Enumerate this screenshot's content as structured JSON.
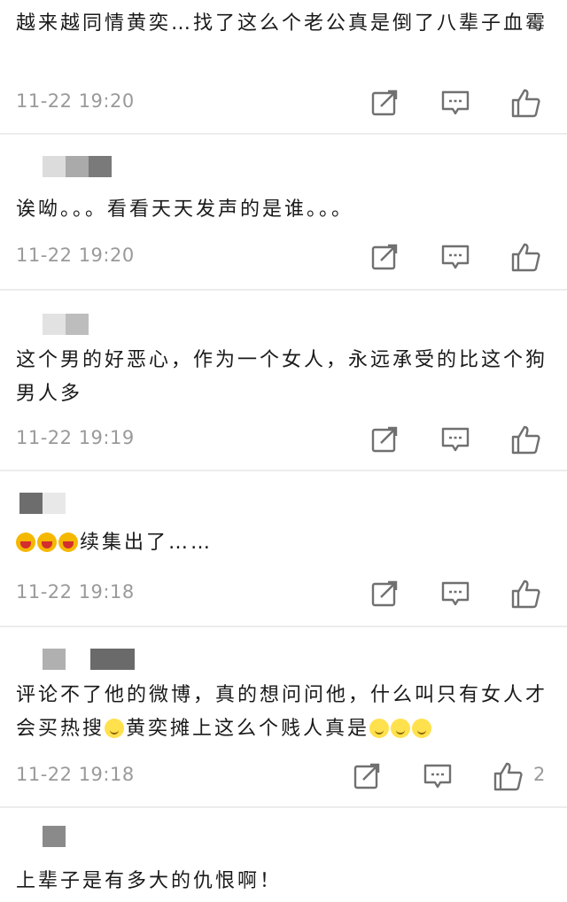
{
  "comments": [
    {
      "text": "越来越同情黄奕…找了这么个老公真是倒了八辈子血霉",
      "time": "11-22 19:20"
    },
    {
      "text": "诶呦。。。看看天天发声的是谁。。。",
      "time": "11-22 19:20"
    },
    {
      "text": "这个男的好恶心，作为一个女人，永远承受的比这个狗男人多",
      "time": "11-22 19:19"
    },
    {
      "emojis": [
        "laugh-emoji",
        "laugh-emoji",
        "laugh-emoji"
      ],
      "text": "续集出了……",
      "time": "11-22 19:18"
    },
    {
      "text_part1": "评论不了他的微博，真的想问问他，什么叫只有女人才会买热搜",
      "text_part2": "黄奕摊上这么个贱人真是",
      "emojis": [
        "smile-emoji",
        "smile-emoji",
        "smile-emoji",
        "smile-emoji"
      ],
      "time": "11-22 19:18",
      "like_count": "2"
    },
    {
      "text": "上辈子是有多大的仇恨啊！"
    }
  ],
  "icons": {
    "share": "share-icon",
    "reply": "comment-icon",
    "like": "thumbs-up-icon"
  },
  "colors": {
    "text": "#1a1a1a",
    "meta": "#9a9a9a",
    "divider": "#ececec",
    "icon": "#707070"
  }
}
